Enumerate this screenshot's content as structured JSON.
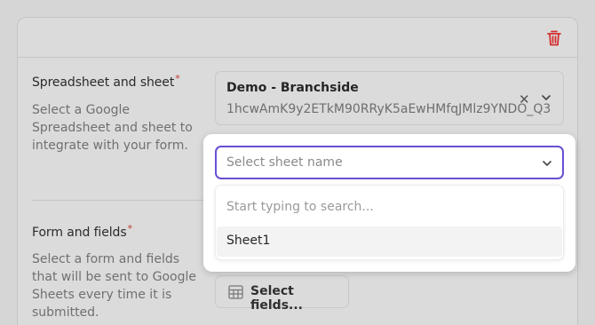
{
  "spreadsheet_field": {
    "label": "Spreadsheet and sheet",
    "required_marker": "*",
    "description": [
      "Select a Google",
      "Spreadsheet and sheet to",
      "integrate with your form."
    ],
    "selected_title": "Demo - Branchside",
    "selected_id": "1hcwAmK9y2ETkM90RRyK5aEwHMfqJMlz9YNDO_Q3",
    "clear_glyph": "✕"
  },
  "form_field": {
    "label": "Form and fields",
    "required_marker": "*",
    "description": [
      "Select a form and fields",
      "that will be sent to Google",
      "Sheets every time it is",
      "submitted."
    ],
    "button_label": "Select fields..."
  },
  "sheet_dropdown": {
    "placeholder": "Select sheet name",
    "search_placeholder": "Start typing to search...",
    "options": [
      "Sheet1"
    ]
  },
  "colors": {
    "accent": "#6a4fd3",
    "danger": "#d32f2f"
  },
  "icons": [
    "trash-icon",
    "close-icon",
    "chevron-down-icon",
    "table-icon"
  ]
}
